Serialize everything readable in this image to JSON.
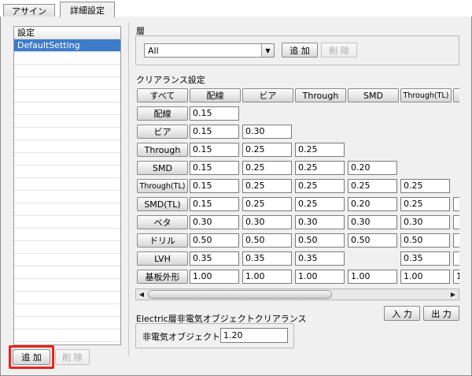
{
  "tabs": [
    {
      "label": "アサイン"
    },
    {
      "label": "詳細設定"
    }
  ],
  "settings_list": {
    "header": "設定",
    "items": [
      "DefaultSetting"
    ],
    "add_label": "追 加",
    "delete_label": "削 除"
  },
  "layer": {
    "title": "層",
    "selected": "All",
    "add_label": "追 加",
    "delete_label": "削 除"
  },
  "clearance": {
    "title": "クリアランス設定",
    "columns": [
      "すべて",
      "配線",
      "ビア",
      "Through",
      "SMD",
      "Through(TL)"
    ],
    "rows": [
      {
        "label": "配線",
        "values": [
          "0.15"
        ]
      },
      {
        "label": "ビア",
        "values": [
          "0.15",
          "0.30"
        ]
      },
      {
        "label": "Through",
        "values": [
          "0.15",
          "0.25",
          "0.25"
        ]
      },
      {
        "label": "SMD",
        "values": [
          "0.15",
          "0.25",
          "0.25",
          "0.20"
        ]
      },
      {
        "label": "Through(TL)",
        "values": [
          "0.15",
          "0.25",
          "0.25",
          "0.25",
          "0.25"
        ]
      },
      {
        "label": "SMD(TL)",
        "values": [
          "0.15",
          "0.25",
          "0.25",
          "0.20",
          "0.25",
          ""
        ]
      },
      {
        "label": "ベタ",
        "values": [
          "0.30",
          "0.30",
          "0.30",
          "0.30",
          "0.30",
          ""
        ]
      },
      {
        "label": "ドリル",
        "values": [
          "0.50",
          "0.50",
          "0.50",
          "0.50",
          "0.50",
          ""
        ]
      },
      {
        "label": "LVH",
        "values": [
          "0.35",
          "0.35",
          "0.35",
          "",
          "0.35",
          ""
        ]
      },
      {
        "label": "基板外形",
        "values": [
          "1.00",
          "1.00",
          "1.00",
          "1.00",
          "1.00",
          "1"
        ]
      }
    ],
    "input_label": "入 力",
    "output_label": "出 力"
  },
  "electric": {
    "title": "Electric層非電気オブジェクトクリアランス",
    "field_label": "非電気オブジェクト",
    "field_value": "1.20"
  },
  "colors": {
    "selection": "#3d7cc9",
    "highlight": "#e8231f"
  },
  "icons": {
    "dropdown": "chevron-down-icon",
    "scroll_left": "arrow-left-icon",
    "scroll_right": "arrow-right-icon"
  }
}
